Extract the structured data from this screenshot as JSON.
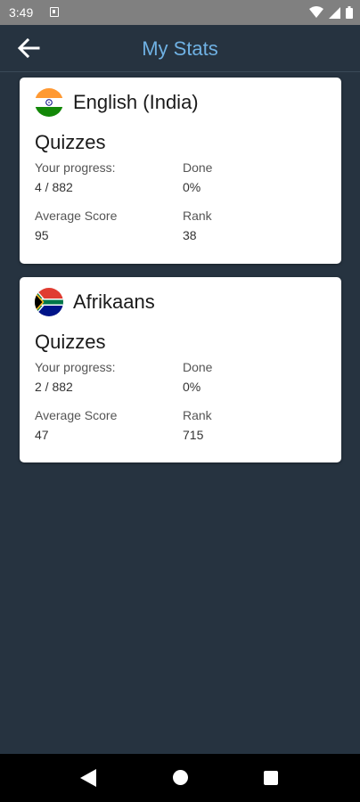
{
  "status_bar": {
    "time": "3:49"
  },
  "app_bar": {
    "title": "My Stats"
  },
  "cards": [
    {
      "language": "English (India)",
      "flag": "india-flag",
      "section_title": "Quizzes",
      "progress_label": "Your progress:",
      "progress_value": "4 / 882",
      "done_label": "Done",
      "done_value": "0%",
      "avg_label": "Average Score",
      "avg_value": "95",
      "rank_label": "Rank",
      "rank_value": "38"
    },
    {
      "language": "Afrikaans",
      "flag": "south-africa-flag",
      "section_title": "Quizzes",
      "progress_label": "Your progress:",
      "progress_value": "2 / 882",
      "done_label": "Done",
      "done_value": "0%",
      "avg_label": "Average Score",
      "avg_value": "47",
      "rank_label": "Rank",
      "rank_value": "715"
    }
  ],
  "colors": {
    "background": "#263340",
    "title_accent": "#6fb1e3",
    "card": "#ffffff"
  }
}
